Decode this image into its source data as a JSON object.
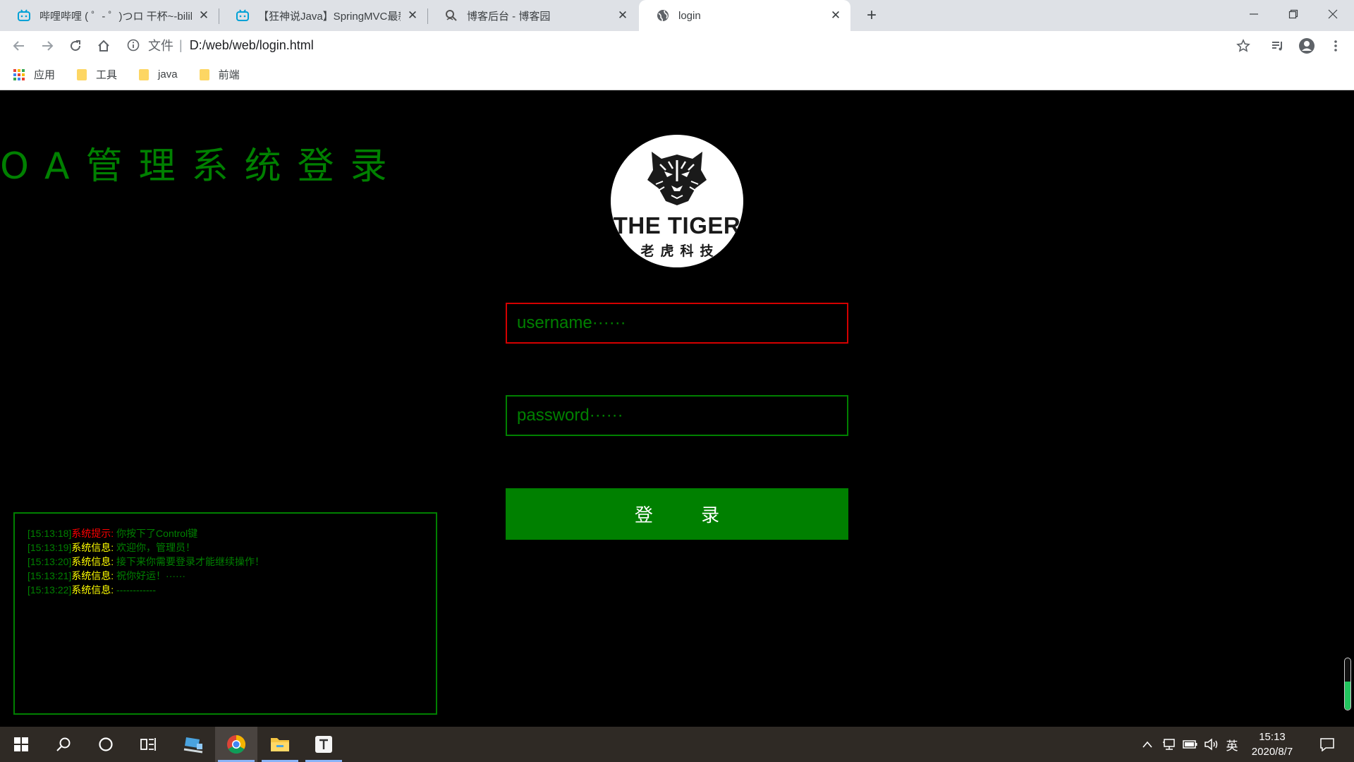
{
  "browser": {
    "tabs": [
      {
        "title": "哔哩哔哩 ( ゜- ゜)つロ 干杯~-bilibili",
        "icon": "bilibili-icon"
      },
      {
        "title": "【狂神说Java】SpringMVC最新教程",
        "icon": "bilibili-icon"
      },
      {
        "title": "博客后台 - 博客园",
        "icon": "cnblogs-icon"
      },
      {
        "title": "login",
        "icon": "globe-icon"
      }
    ],
    "address": {
      "scheme": "文件",
      "url": "D:/web/web/login.html"
    },
    "bookmarks": [
      {
        "label": "应用",
        "icon": "apps-grid-icon"
      },
      {
        "label": "工具",
        "icon": "folder-icon"
      },
      {
        "label": "java",
        "icon": "folder-icon"
      },
      {
        "label": "前端",
        "icon": "folder-icon"
      }
    ]
  },
  "page": {
    "title": "OA管理系统登录",
    "logo": {
      "main": "THE TIGER",
      "sub": "老虎科技"
    },
    "username_placeholder": "username······",
    "password_placeholder": "password······",
    "login_label": "登 录",
    "colors": {
      "accent": "#008000",
      "error_border": "#d40000",
      "warn_label": "#ff0000",
      "info_label": "#ffff00"
    },
    "log": [
      {
        "time": "[15:13:18]",
        "label": "系统提示:",
        "type": "warn",
        "msg": " 你按下了Control键"
      },
      {
        "time": "[15:13:19]",
        "label": "系统信息:",
        "type": "info",
        "msg": " 欢迎你，管理员！"
      },
      {
        "time": "[15:13:20]",
        "label": "系统信息:",
        "type": "info",
        "msg": " 接下来你需要登录才能继续操作！"
      },
      {
        "time": "[15:13:21]",
        "label": "系统信息:",
        "type": "info",
        "msg": " 祝你好运！······"
      },
      {
        "time": "[15:13:22]",
        "label": "系统信息:",
        "type": "info",
        "msg": " ------------"
      }
    ]
  },
  "taskbar": {
    "ime": "英",
    "time": "15:13",
    "date": "2020/8/7"
  }
}
